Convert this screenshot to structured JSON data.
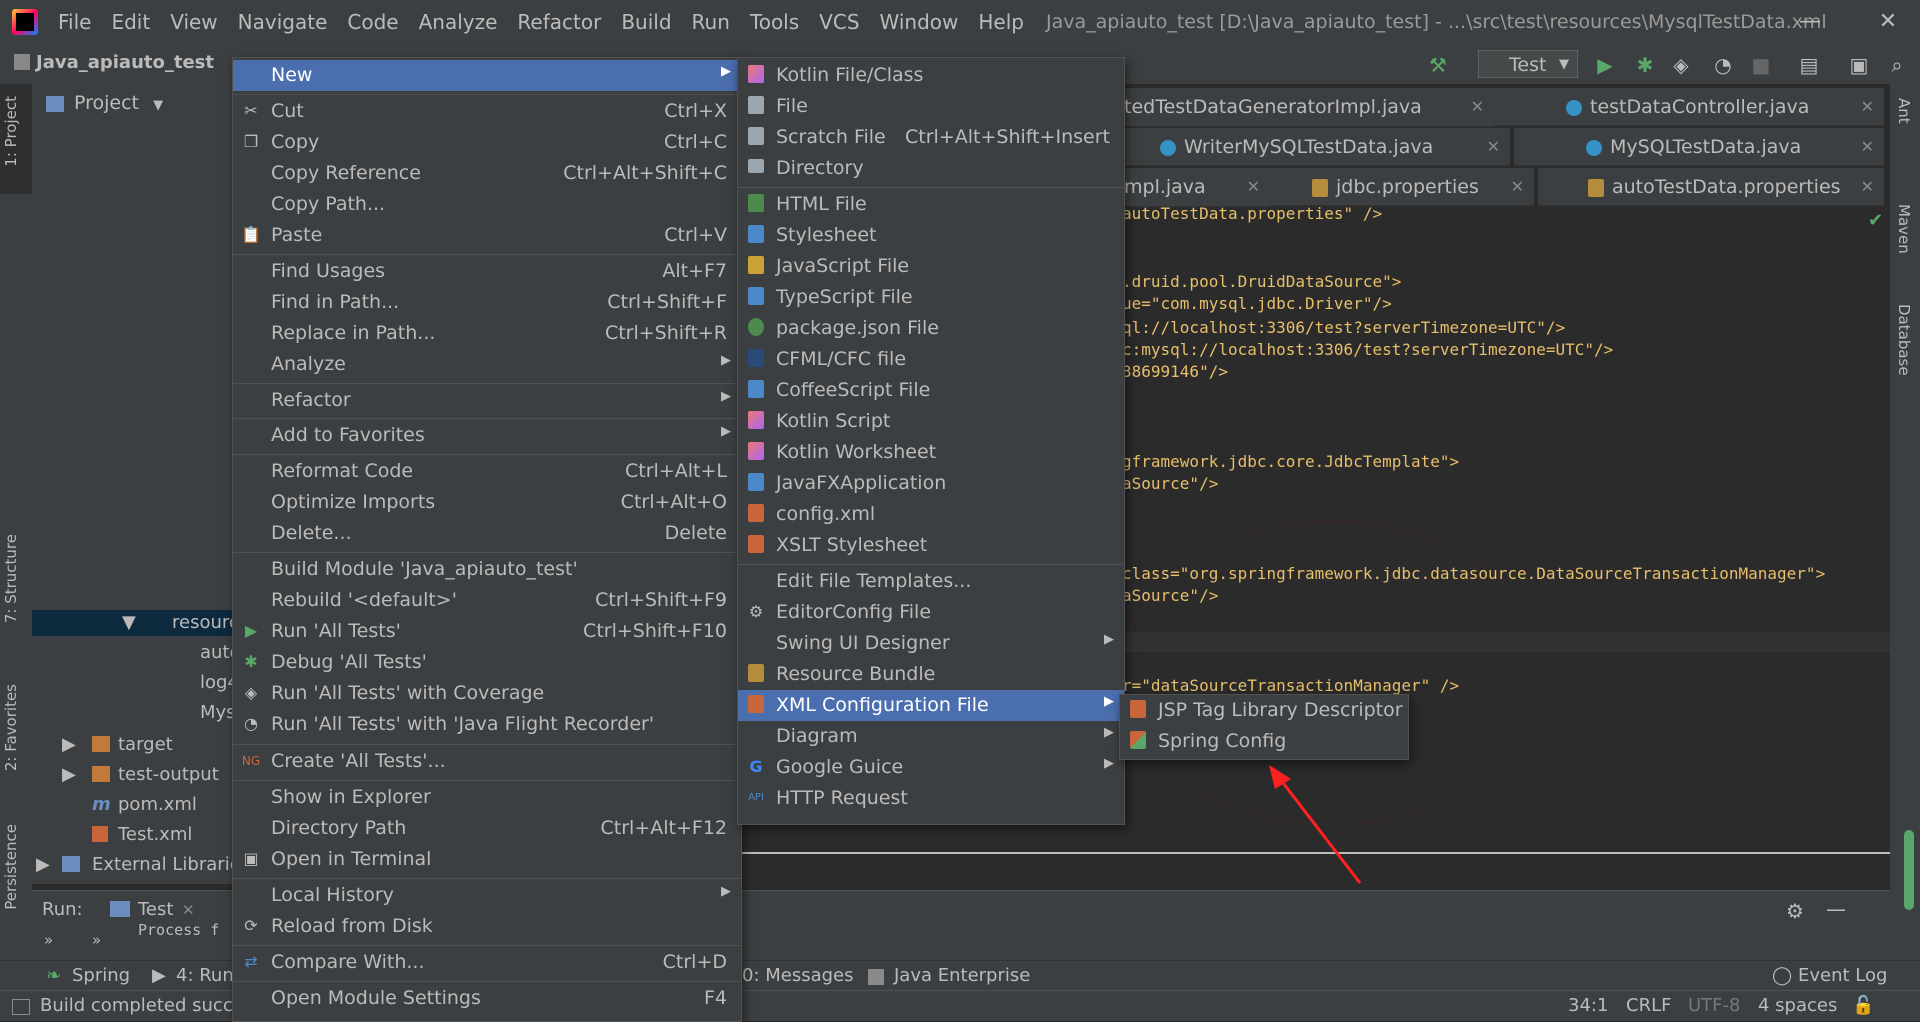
{
  "menubar": {
    "items": [
      "File",
      "Edit",
      "View",
      "Navigate",
      "Code",
      "Analyze",
      "Refactor",
      "Build",
      "Run",
      "Tools",
      "VCS",
      "Window",
      "Help"
    ],
    "window_title": "Java_apiauto_test [D:\\Java_apiauto_test] - ...\\src\\test\\resources\\MysqlTestData.xml"
  },
  "navbar": {
    "project": "Java_apiauto_test",
    "run_config": "Test"
  },
  "left_strip": {
    "project": "1: Project",
    "structure": "7: Structure",
    "favorites": "2: Favorites",
    "persistence": "Persistence"
  },
  "right_strip": {
    "ant": "Ant",
    "maven": "Maven",
    "database": "Database"
  },
  "project_panel": {
    "header": "Project",
    "rows": [
      "resourc",
      "auto",
      "log4",
      "Mys",
      "target",
      "test-output",
      "pom.xml",
      "Test.xml",
      "External Librarie"
    ]
  },
  "tabs": {
    "row1": [
      "tedTestDataGeneratorImpl.java",
      "testDataController.java"
    ],
    "row2": [
      "WriterMySQLTestData.java",
      "MySQLTestData.java"
    ],
    "row3": [
      "mpl.java",
      "jdbc.properties",
      "autoTestData.properties"
    ]
  },
  "code": {
    "l1": "autoTestData.properties\" />",
    "l2": ".druid.pool.DruidDataSource\">",
    "l3": "ue=\"com.mysql.jdbc.Driver\"/>",
    "l4": "ql://localhost:3306/test?serverTimezone=UTC\"/>",
    "l5": "c:mysql://localhost:3306/test?serverTimezone=UTC\"/>",
    "l6": "38699146\"/>",
    "l7": "gframework.jdbc.core.JdbcTemplate\">",
    "l8": "aSource\"/>",
    "l9": "class=\"org.springframework.jdbc.datasource.DataSourceTransactionManager\">",
    "l10": "aSource\"/>",
    "l11": "r=\"dataSourceTransactionManager\" />"
  },
  "context_menu": {
    "new": "New",
    "cut": "Cut",
    "cut_sc": "Ctrl+X",
    "copy": "Copy",
    "copy_sc": "Ctrl+C",
    "copy_ref": "Copy Reference",
    "copy_ref_sc": "Ctrl+Alt+Shift+C",
    "copy_path": "Copy Path...",
    "paste": "Paste",
    "paste_sc": "Ctrl+V",
    "find_usages": "Find Usages",
    "find_usages_sc": "Alt+F7",
    "find_in_path": "Find in Path...",
    "find_in_path_sc": "Ctrl+Shift+F",
    "replace_in_path": "Replace in Path...",
    "replace_in_path_sc": "Ctrl+Shift+R",
    "analyze": "Analyze",
    "refactor": "Refactor",
    "add_fav": "Add to Favorites",
    "reformat": "Reformat Code",
    "reformat_sc": "Ctrl+Alt+L",
    "optimize": "Optimize Imports",
    "optimize_sc": "Ctrl+Alt+O",
    "delete": "Delete...",
    "delete_sc": "Delete",
    "build_module": "Build Module 'Java_apiauto_test'",
    "rebuild": "Rebuild '<default>'",
    "rebuild_sc": "Ctrl+Shift+F9",
    "run_all": "Run 'All Tests'",
    "run_all_sc": "Ctrl+Shift+F10",
    "debug_all": "Debug 'All Tests'",
    "run_cov": "Run 'All Tests' with Coverage",
    "run_jfr": "Run 'All Tests' with 'Java Flight Recorder'",
    "create_all": "Create 'All Tests'...",
    "show_explorer": "Show in Explorer",
    "dir_path": "Directory Path",
    "dir_path_sc": "Ctrl+Alt+F12",
    "open_terminal": "Open in Terminal",
    "local_history": "Local History",
    "reload": "Reload from Disk",
    "compare": "Compare With...",
    "compare_sc": "Ctrl+D",
    "module_settings": "Open Module Settings",
    "module_settings_sc": "F4"
  },
  "new_menu": {
    "kotlin_class": "Kotlin File/Class",
    "file": "File",
    "scratch": "Scratch File",
    "scratch_sc": "Ctrl+Alt+Shift+Insert",
    "directory": "Directory",
    "html": "HTML File",
    "stylesheet": "Stylesheet",
    "js": "JavaScript File",
    "ts": "TypeScript File",
    "package_json": "package.json File",
    "cfml": "CFML/CFC file",
    "coffee": "CoffeeScript File",
    "kotlin_script": "Kotlin Script",
    "kotlin_worksheet": "Kotlin Worksheet",
    "javafx": "JavaFXApplication",
    "config_xml": "config.xml",
    "xslt": "XSLT Stylesheet",
    "edit_templates": "Edit File Templates...",
    "editorconfig": "EditorConfig File",
    "swing": "Swing UI Designer",
    "resource_bundle": "Resource Bundle",
    "xml_config": "XML Configuration File",
    "diagram": "Diagram",
    "guice": "Google Guice",
    "http": "HTTP Request"
  },
  "xml_menu": {
    "jsp_tld": "JSP Tag Library Descriptor",
    "spring_config": "Spring Config"
  },
  "run_panel": {
    "label": "Run:",
    "tab": "Test",
    "output": "Process f"
  },
  "bottom_tabs": {
    "spring": "Spring",
    "run": "4: Run",
    "messages": "0: Messages",
    "java_ee": "Java Enterprise",
    "event_log": "Event Log"
  },
  "statusbar": {
    "message": "Build completed succe",
    "pos": "34:1",
    "line_sep": "CRLF",
    "encoding": "UTF-8",
    "indent": "4 spaces"
  },
  "colors": {
    "accent": "#4b6eaf",
    "background": "#2b2b2b",
    "panel": "#3c3f41",
    "arrow": "#ff2020"
  }
}
